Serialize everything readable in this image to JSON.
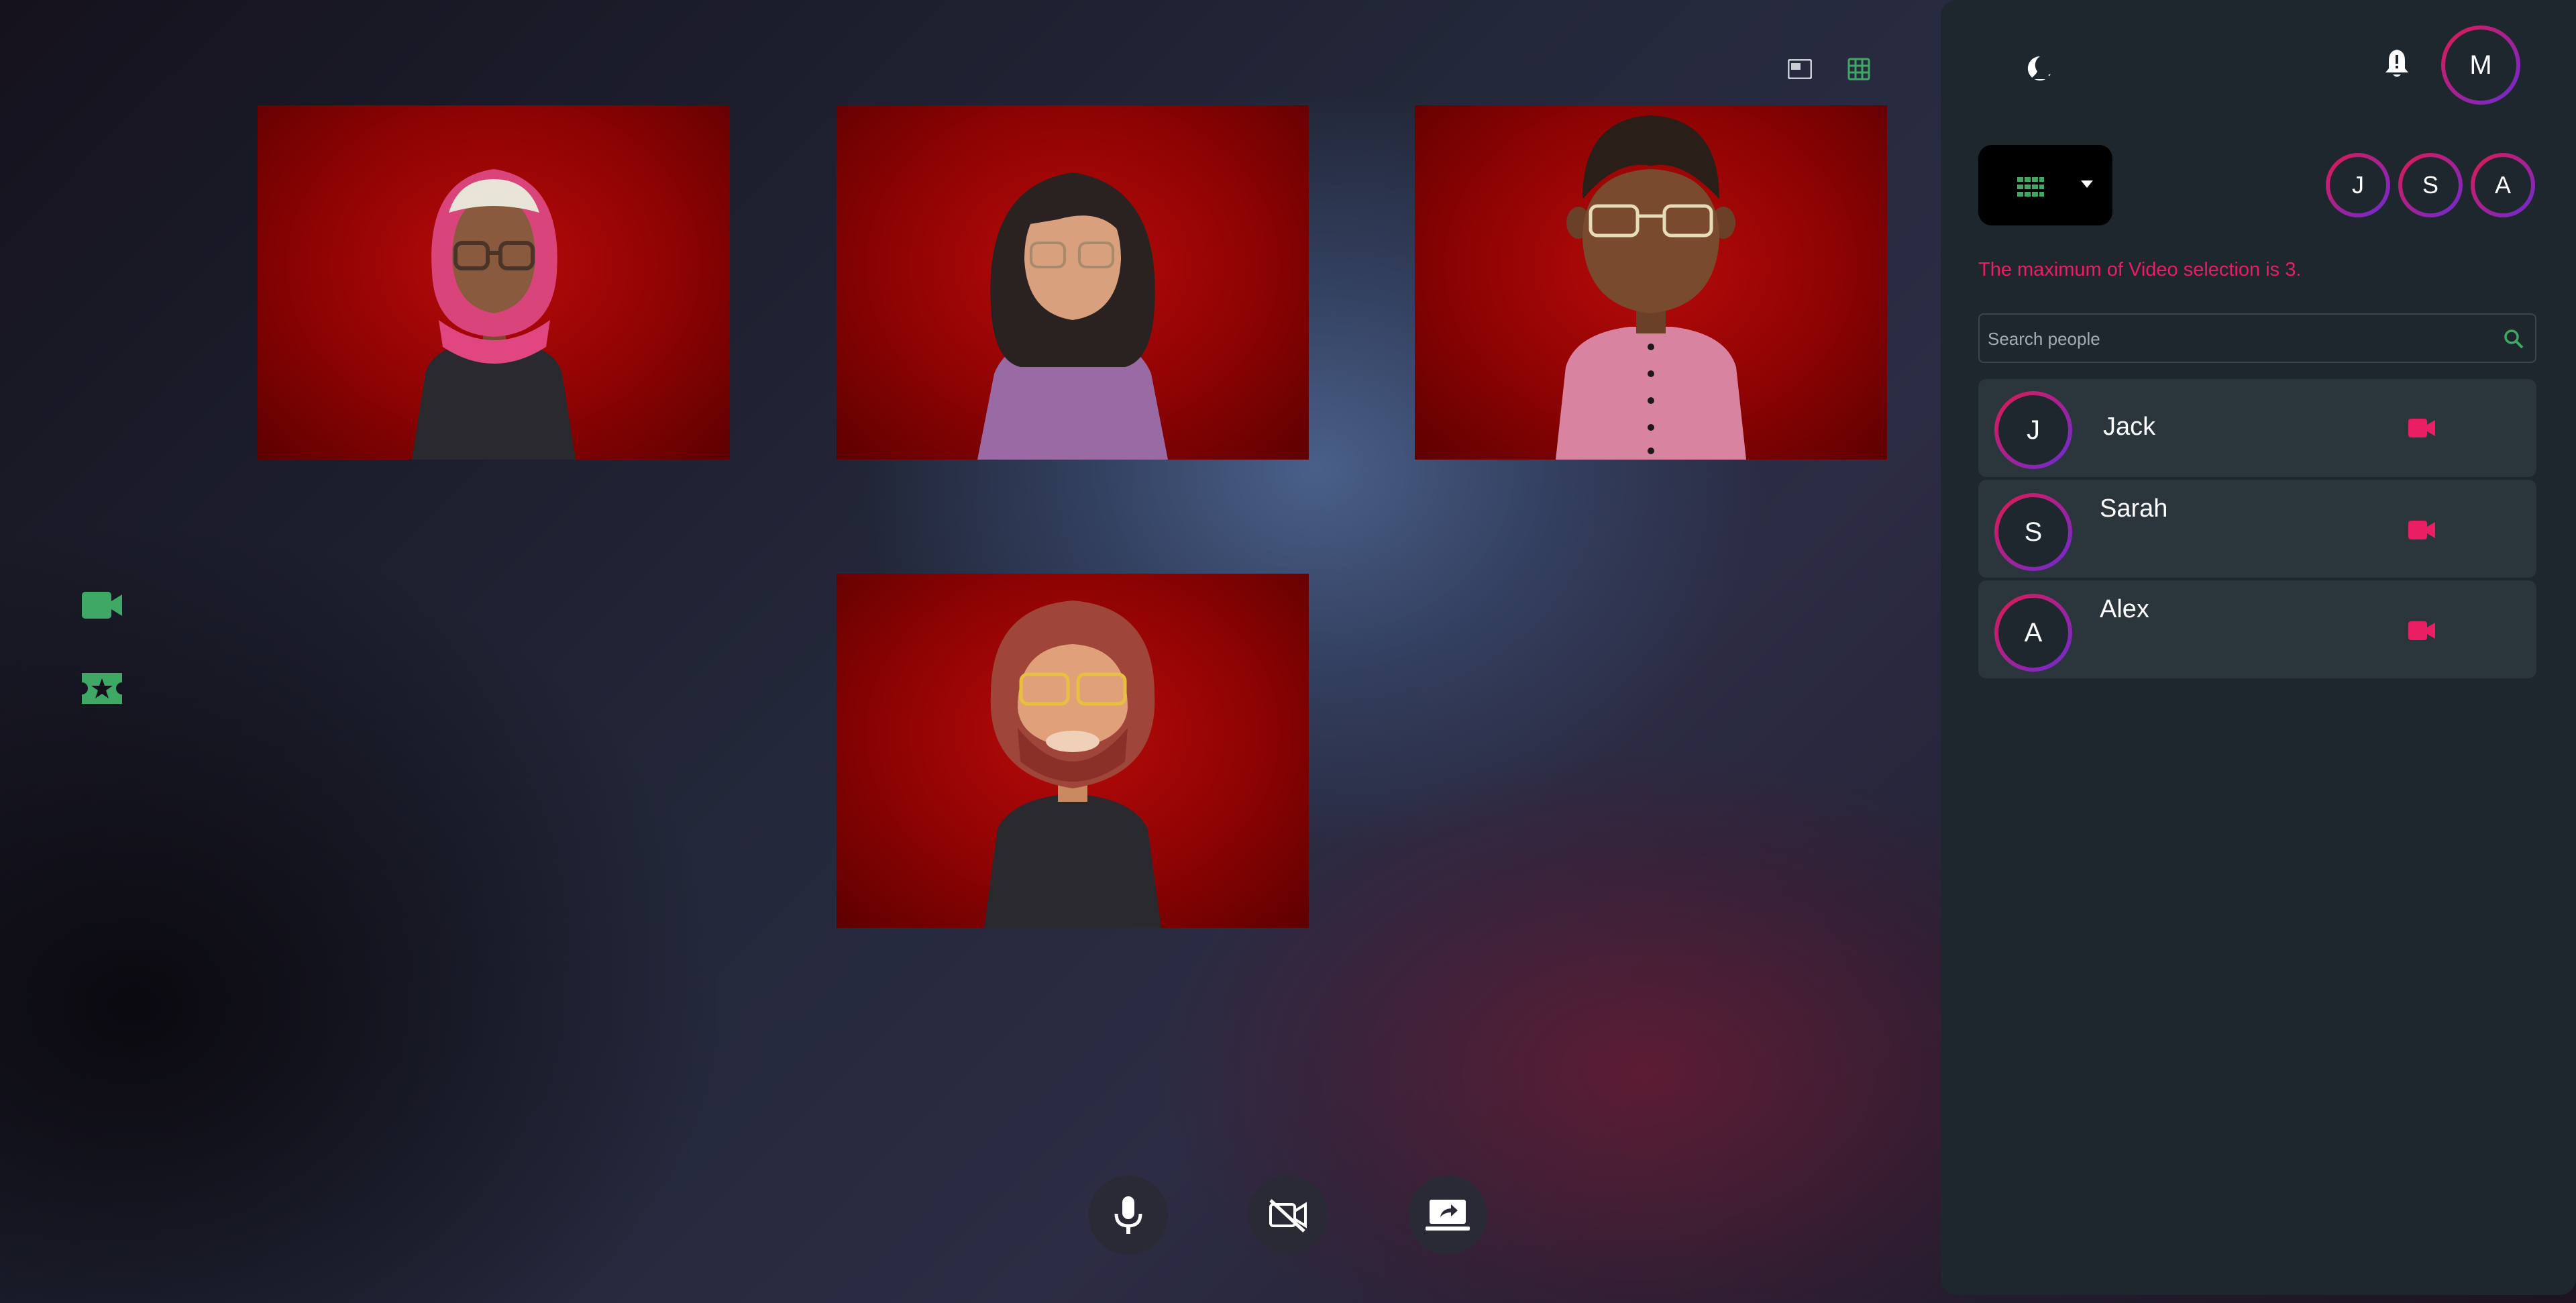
{
  "colors": {
    "accent_green": "#3fa864",
    "alert_pink": "#e91e63",
    "panel_bg": "#1e272d",
    "list_item_bg": "#2b353c",
    "avatar_ring": [
      "#e01a4f",
      "#6a2bd6"
    ],
    "tile_bg": "#a00808"
  },
  "stage": {
    "layout_buttons": [
      {
        "name": "spotlight-layout",
        "icon": "picture-in-picture-icon"
      },
      {
        "name": "grid-layout",
        "icon": "grid-icon"
      }
    ],
    "participants": [
      {
        "name": "tile-1",
        "avatar": "woman-hijab"
      },
      {
        "name": "tile-2",
        "avatar": "woman-long-hair"
      },
      {
        "name": "tile-3",
        "avatar": "man-curly-hair"
      },
      {
        "name": "tile-4",
        "avatar": "man-beard"
      }
    ]
  },
  "side_tools": [
    {
      "name": "video-tool",
      "icon": "video-camera-icon"
    },
    {
      "name": "effects-tool",
      "icon": "ticket-star-icon"
    }
  ],
  "controls": [
    {
      "name": "mic",
      "icon": "microphone-icon"
    },
    {
      "name": "camera-off",
      "icon": "video-off-icon"
    },
    {
      "name": "share-screen",
      "icon": "screen-share-icon"
    }
  ],
  "panel": {
    "theme_icon": "moon-icon",
    "notification_icon": "bell-alert-icon",
    "user_initial": "M",
    "view_mode_icon": "grid-icon",
    "selected_initials": [
      "J",
      "S",
      "A"
    ],
    "warning": "The maximum of Video selection is 3.",
    "search": {
      "placeholder": "Search people",
      "value": ""
    },
    "people": [
      {
        "initial": "J",
        "name": "Jack",
        "video": true
      },
      {
        "initial": "S",
        "name": "Sarah",
        "video": true
      },
      {
        "initial": "A",
        "name": "Alex",
        "video": true
      }
    ]
  }
}
